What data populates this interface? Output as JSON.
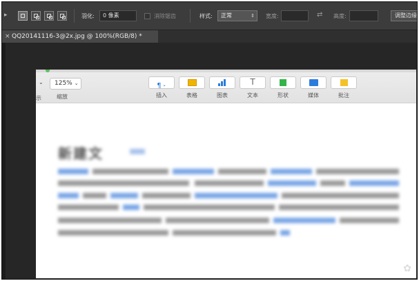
{
  "options_bar": {
    "feather_label": "羽化:",
    "feather_value": "0 像素",
    "antialias_label": "消除锯齿",
    "style_label": "样式:",
    "style_value": "正常",
    "width_label": "宽度:",
    "height_label": "高度:",
    "refine_edge_label": "调整边缘"
  },
  "document_tab": {
    "title": "QQ20141116-3@2x.jpg @ 100%(RGB/8) *",
    "close_glyph": "×"
  },
  "embedded_app": {
    "partial_left_label": "示",
    "zoom_value": "125%",
    "zoom_label": "缩放",
    "tools": [
      {
        "label": "插入",
        "icon": "paragraph-insert-icon"
      },
      {
        "label": "表格",
        "icon": "table-icon"
      },
      {
        "label": "图表",
        "icon": "chart-icon"
      },
      {
        "label": "文本",
        "icon": "text-icon"
      },
      {
        "label": "形状",
        "icon": "shape-icon"
      },
      {
        "label": "媒体",
        "icon": "media-icon"
      },
      {
        "label": "批注",
        "icon": "comment-icon"
      }
    ],
    "blurred_heading": "新建文"
  },
  "colors": {
    "photoshop_bar": "#3c3c3c",
    "canvas": "#262626",
    "accent_blue": "#2b7bdc",
    "table_yellow": "#f0b400",
    "shape_green": "#34b34a"
  }
}
